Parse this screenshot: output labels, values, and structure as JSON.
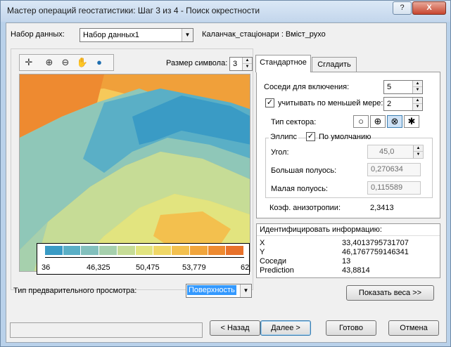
{
  "window": {
    "title": "Мастер операций геостатистики: Шаг 3 из 4 - Поиск окрестности",
    "help_label": "?",
    "close_label": "X"
  },
  "dataset": {
    "label": "Набор данных:",
    "value": "Набор данных1",
    "layer_text": "Каланчак_стаціонари : Вміст_рухо"
  },
  "toolbar": {
    "icons": [
      "crosshair-icon",
      "zoom-in-icon",
      "zoom-out-icon",
      "pan-hand-icon",
      "globe-icon"
    ]
  },
  "symbol_size": {
    "label": "Размер символа:",
    "value": "3"
  },
  "tabs": {
    "standard": "Стандартное",
    "smooth": "Сгладить"
  },
  "standard": {
    "neighbors_label": "Соседи для включения:",
    "neighbors_value": "5",
    "at_least_label": "учитывать по меньшей мере:",
    "at_least_checked": true,
    "at_least_value": "2",
    "sector_label": "Тип сектора:",
    "ellipse_label": "Эллипс",
    "default_label": "По умолчанию",
    "default_checked": true,
    "angle_label": "Угол:",
    "angle_value": "45,0",
    "major_label": "Большая полуось:",
    "major_value": "0,270634",
    "minor_label": "Малая полуось:",
    "minor_value": "0,115589",
    "anisotropy_label": "Коэф. анизотропии:",
    "anisotropy_value": "2,3413"
  },
  "identify": {
    "header": "Идентифицировать информацию:",
    "rows": [
      {
        "key": "X",
        "value": "33,4013795731707"
      },
      {
        "key": "Y",
        "value": "46,1767759146341"
      },
      {
        "key": "Соседи",
        "value": "13"
      },
      {
        "key": "Prediction",
        "value": "43,8814"
      }
    ]
  },
  "legend": {
    "labels": [
      "36",
      "46,325",
      "50,475",
      "53,779",
      "62"
    ],
    "colors": [
      "#3a9bc5",
      "#5aafc6",
      "#82c0bd",
      "#a6d0ad",
      "#c6dc96",
      "#e2e47f",
      "#f0d766",
      "#f3c04e",
      "#f1a53c",
      "#ee8a30",
      "#e8712a"
    ]
  },
  "preview": {
    "label": "Тип предварительного просмотра:",
    "value": "Поверхность"
  },
  "buttons": {
    "show_weights": "Показать веса >>",
    "back": "< Назад",
    "next": "Далее >",
    "finish": "Готово",
    "cancel": "Отмена"
  },
  "colors": {
    "window_frame": "#b9d1ea",
    "selection": "#3399ff"
  }
}
